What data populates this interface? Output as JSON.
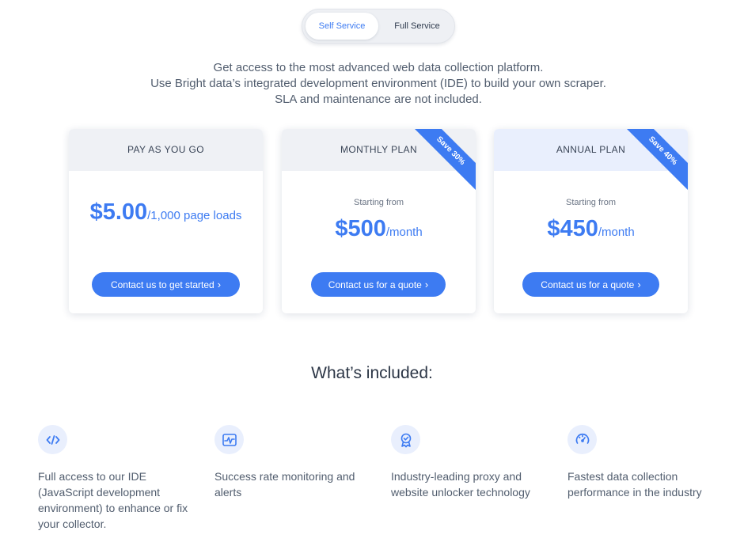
{
  "toggle": {
    "self_service": "Self Service",
    "full_service": "Full Service"
  },
  "intro": {
    "line1": "Get access to the most advanced web data collection platform.",
    "line2": "Use Bright data’s integrated development environment (IDE) to build your own scraper.",
    "line3": "SLA and maintenance are not included."
  },
  "plans": [
    {
      "name": "PAY AS YOU GO",
      "starting": "",
      "price": "$5.00",
      "unit": "/1,000 page loads",
      "cta": "Contact us to get started",
      "ribbon": ""
    },
    {
      "name": "MONTHLY PLAN",
      "starting": "Starting from",
      "price": "$500",
      "unit": "/month",
      "cta": "Contact us for a quote",
      "ribbon": "Save 30%"
    },
    {
      "name": "ANNUAL PLAN",
      "starting": "Starting from",
      "price": "$450",
      "unit": "/month",
      "cta": "Contact us for a quote",
      "ribbon": "Save 40%"
    }
  ],
  "included": {
    "title": "What’s included:",
    "features": [
      {
        "icon": "code-icon",
        "text": "Full access to our IDE (JavaScript development environment) to enhance or fix your collector."
      },
      {
        "icon": "monitor-pulse-icon",
        "text": "Success rate monitoring and alerts"
      },
      {
        "icon": "award-badge-icon",
        "text": "Industry-leading proxy and website unlocker technology"
      },
      {
        "icon": "speedometer-icon",
        "text": "Fastest data collection performance in the industry"
      }
    ]
  },
  "colors": {
    "accent": "#3d7bf2",
    "card_head": "#eff1f5",
    "icon_bg": "#e9effd"
  }
}
